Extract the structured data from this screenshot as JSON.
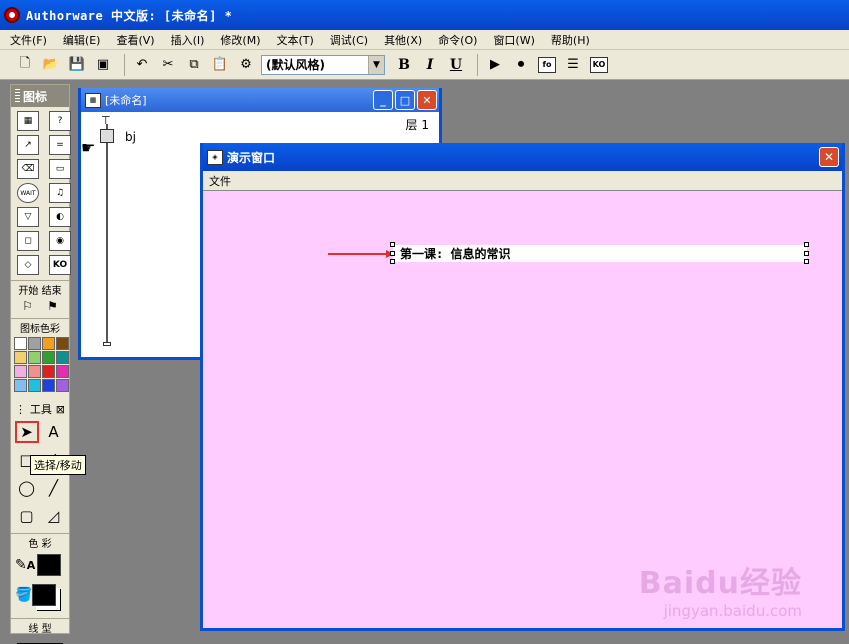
{
  "app": {
    "title": "Authorware 中文版: [未命名] *"
  },
  "menubar": {
    "items": [
      "文件(F)",
      "编辑(E)",
      "查看(V)",
      "插入(I)",
      "修改(M)",
      "文本(T)",
      "调试(C)",
      "其他(X)",
      "命令(O)",
      "窗口(W)",
      "帮助(H)"
    ]
  },
  "toolbar": {
    "style_select_value": "(默认风格)",
    "bold_label": "B",
    "italic_label": "I",
    "underline_label": "U",
    "fo_label": "fo",
    "ko_label": "KO"
  },
  "palette": {
    "title": "图标",
    "start_end_label": "开始 结束",
    "icon_color_label": "图标色彩",
    "icon_colors": [
      "#ffffff",
      "#a0a0a0",
      "#f0a020",
      "#7a4a10",
      "#f0d070",
      "#90d070",
      "#30a030",
      "#109090",
      "#f0b0e0",
      "#f09090",
      "#e02020",
      "#e030b0",
      "#80c0f0",
      "#20c0e0",
      "#2040e0",
      "#a060e0"
    ],
    "wait_label": "WAIT",
    "ko_label": "KO"
  },
  "tools": {
    "title": "工具",
    "text_tool_label": "A",
    "tooltip": "选择/移动",
    "color_label": "色 彩",
    "line_label": "线 型",
    "pencil_a_label": "A"
  },
  "flow_window": {
    "title": "[未命名]",
    "layer_label": "层 1",
    "item_label": "bj"
  },
  "pres_window": {
    "title": "演示窗口",
    "menu_file": "文件",
    "text_object": "第一课: 信息的常识"
  },
  "watermark": {
    "logo": "Baidu经验",
    "url": "jingyan.baidu.com"
  }
}
